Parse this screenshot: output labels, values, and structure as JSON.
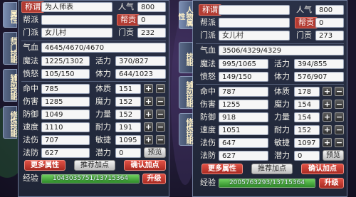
{
  "left": {
    "title_label": "称谓",
    "title_value": "为人师表",
    "popularity_label": "人气",
    "popularity_value": "800",
    "gang_label": "帮派",
    "gang_value": "",
    "contrib_label": "帮贡",
    "contrib_value": "0",
    "school_label": "门派",
    "school_value": "女儿村",
    "school_contrib_label": "门贡",
    "school_contrib_value": "232",
    "qixue_label": "气血",
    "qixue_value": "4645/4670/4670",
    "mofa_label": "魔法",
    "mofa_value": "1225/1302",
    "huoli_label": "活力",
    "huoli_value": "370/827",
    "fennu_label": "愤怒",
    "fennu_value": "105/150",
    "tili_label": "体力",
    "tili_value": "644/1023",
    "attrs": [
      {
        "label": "命中",
        "value": "785",
        "stat": "体质",
        "stat_value": "151"
      },
      {
        "label": "伤害",
        "value": "1285",
        "stat": "魔力",
        "stat_value": "152"
      },
      {
        "label": "防御",
        "value": "1049",
        "stat": "力量",
        "stat_value": "152"
      },
      {
        "label": "速度",
        "value": "1110",
        "stat": "耐力",
        "stat_value": "191"
      },
      {
        "label": "法伤",
        "value": "707",
        "stat": "敏捷",
        "stat_value": "1095"
      }
    ],
    "fafang_label": "法防",
    "fafang_value": "627",
    "qianli_label": "潜力",
    "qianli_value": "0",
    "preview_label": "预览",
    "more_attrs_label": "更多属性",
    "recommend_label": "推荐加点",
    "confirm_label": "确认加点",
    "exp_label": "经验",
    "exp_value": "1043035751/13715364",
    "upgrade_label": "升级",
    "tabs": [
      "属性",
      "师门技能",
      "辅助技能",
      "修炼技能"
    ]
  },
  "right": {
    "title_label": "称谓",
    "title_value": "",
    "popularity_label": "人气",
    "popularity_value": "800",
    "gang_label": "帮派",
    "gang_value": "",
    "contrib_label": "帮贡",
    "contrib_value": "0",
    "school_label": "门派",
    "school_value": "女儿村",
    "school_contrib_label": "门贡",
    "school_contrib_value": "273",
    "qixue_label": "气血",
    "qixue_value": "3506/4329/4329",
    "mofa_label": "魔法",
    "mofa_value": "995/1065",
    "huoli_label": "活力",
    "huoli_value": "394/855",
    "fennu_label": "愤怒",
    "fennu_value": "149/150",
    "tili_label": "体力",
    "tili_value": "576/907",
    "attrs": [
      {
        "label": "命中",
        "value": "787",
        "stat": "体质",
        "stat_value": "178"
      },
      {
        "label": "伤害",
        "value": "1255",
        "stat": "魔力",
        "stat_value": "154"
      },
      {
        "label": "防御",
        "value": "918",
        "stat": "力量",
        "stat_value": "154"
      },
      {
        "label": "速度",
        "value": "1051",
        "stat": "耐力",
        "stat_value": "152"
      },
      {
        "label": "法伤",
        "value": "647",
        "stat": "敏捷",
        "stat_value": "1097"
      }
    ],
    "fafang_label": "法防",
    "fafang_value": "627",
    "qianli_label": "潜力",
    "qianli_value": "0",
    "preview_label": "预览",
    "more_attrs_label": "更多属性",
    "recommend_label": "推荐加点",
    "confirm_label": "确认加点",
    "exp_label": "经验",
    "exp_value": "2005763293/13715364",
    "upgrade_label": "升级",
    "tabs": [
      "人物属性",
      "技能",
      "辅助技能",
      "修炼技能"
    ]
  },
  "plus_symbol": "+",
  "minus_symbol": "−",
  "colors": {
    "accent_red": "#b33c33",
    "exp_green": "#2e8b2a"
  }
}
